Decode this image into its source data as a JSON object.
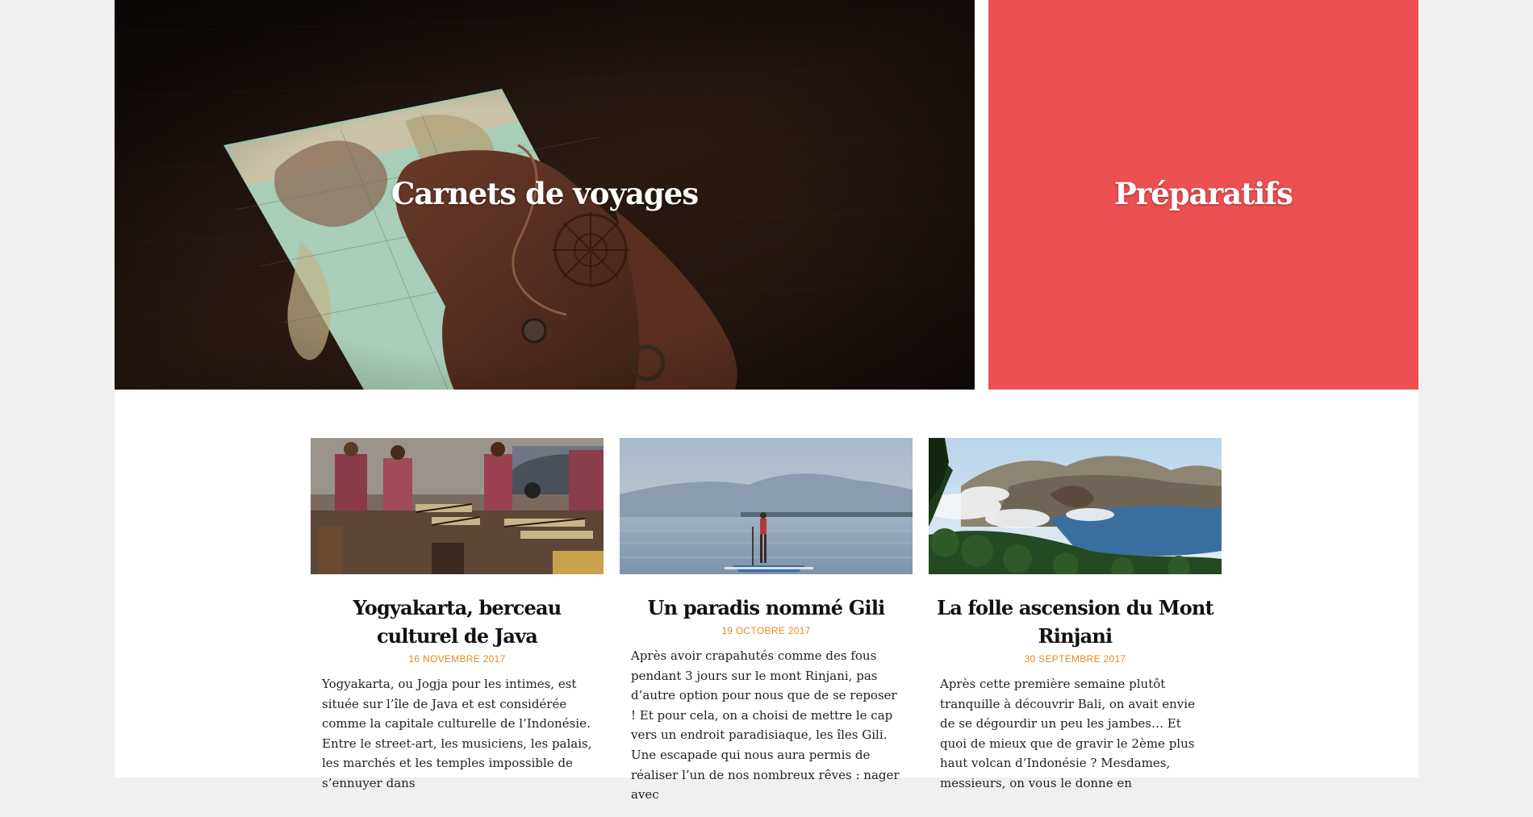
{
  "hero": {
    "left_title": "Carnets de voyages",
    "right_title": "Préparatifs",
    "right_color": "#ec5053"
  },
  "posts": [
    {
      "title": "Yogyakarta, berceau culturel de Java",
      "date": "16 NOVEMBRE 2017",
      "excerpt": "Yogyakarta, ou Jogja pour les intimes, est située sur l’île de Java et est considérée comme la capitale culturelle de l’Indonésie. Entre le street-art, les musiciens, les palais, les marchés et les temples impossible de s’ennuyer dans"
    },
    {
      "title": "Un paradis nommé Gili",
      "date": "19 OCTOBRE 2017",
      "excerpt": "Après avoir crapahutés comme des fous pendant 3 jours sur le mont Rinjani, pas d’autre option pour nous que de se reposer ! Et pour cela, on a choisi de mettre le cap vers un endroit paradisiaque, les îles Gili. Une escapade qui nous aura permis de réaliser l’un de nos nombreux rêves : nager avec"
    },
    {
      "title": "La folle ascension du Mont Rinjani",
      "date": "30 SEPTEMBRE 2017",
      "excerpt": "Après cette première semaine plutôt tranquille à découvrir Bali, on avait envie de se dégourdir un peu les jambes… Et quoi de mieux que de gravir le 2ème plus haut volcan d’Indonésie ? Mesdames, messieurs, on vous le donne en"
    }
  ],
  "colors": {
    "page_background": "#f0f0f0",
    "date_accent": "#e68a1e"
  }
}
